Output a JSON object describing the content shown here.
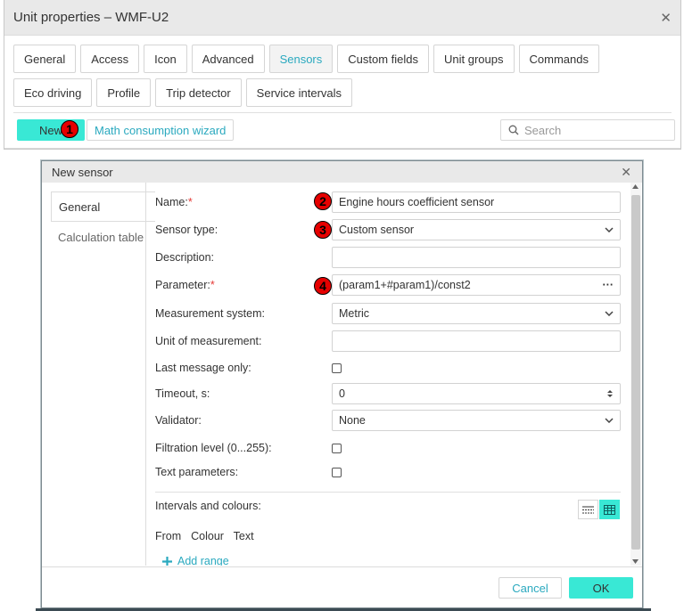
{
  "outer_window": {
    "title": "Unit properties – WMF-U2",
    "close_glyph": "✕",
    "tabs": [
      "General",
      "Access",
      "Icon",
      "Advanced",
      "Sensors",
      "Custom fields",
      "Unit groups",
      "Commands",
      "Eco driving",
      "Profile",
      "Trip detector",
      "Service intervals"
    ],
    "active_tab": "Sensors",
    "toolbar": {
      "new_label": "New",
      "wizard_label": "Math consumption wizard",
      "search_placeholder": "Search"
    }
  },
  "markers": [
    "1",
    "2",
    "3",
    "4"
  ],
  "dialog": {
    "title": "New sensor",
    "close_glyph": "✕",
    "side_tabs": [
      "General",
      "Calculation table"
    ],
    "active_side_tab": "General",
    "fields": {
      "name": {
        "label": "Name:",
        "required_mark": "*",
        "value": "Engine hours coefficient sensor"
      },
      "sensor_type": {
        "label": "Sensor type:",
        "value": "Custom sensor"
      },
      "description": {
        "label": "Description:",
        "value": ""
      },
      "parameter": {
        "label": "Parameter:",
        "required_mark": "*",
        "value": "(param1+#param1)/const2",
        "more_glyph": "···"
      },
      "measurement_system": {
        "label": "Measurement system:",
        "value": "Metric"
      },
      "unit_of_measurement": {
        "label": "Unit of measurement:",
        "value": ""
      },
      "last_message_only": {
        "label": "Last message only:",
        "checked": false
      },
      "timeout": {
        "label": "Timeout, s:",
        "value": "0"
      },
      "validator": {
        "label": "Validator:",
        "value": "None"
      },
      "filtration_level": {
        "label": "Filtration level (0...255):",
        "checked": false
      },
      "text_parameters": {
        "label": "Text parameters:",
        "checked": false
      }
    },
    "intervals": {
      "label": "Intervals and colours:",
      "columns_header": "From  Colour  Text",
      "add_range_label": "Add range"
    },
    "buttons": {
      "cancel": "Cancel",
      "ok": "OK"
    }
  },
  "colors": {
    "accent": "#39e8d5",
    "link": "#2aa9bf",
    "marker": "#e60000",
    "required": "#e53935"
  }
}
